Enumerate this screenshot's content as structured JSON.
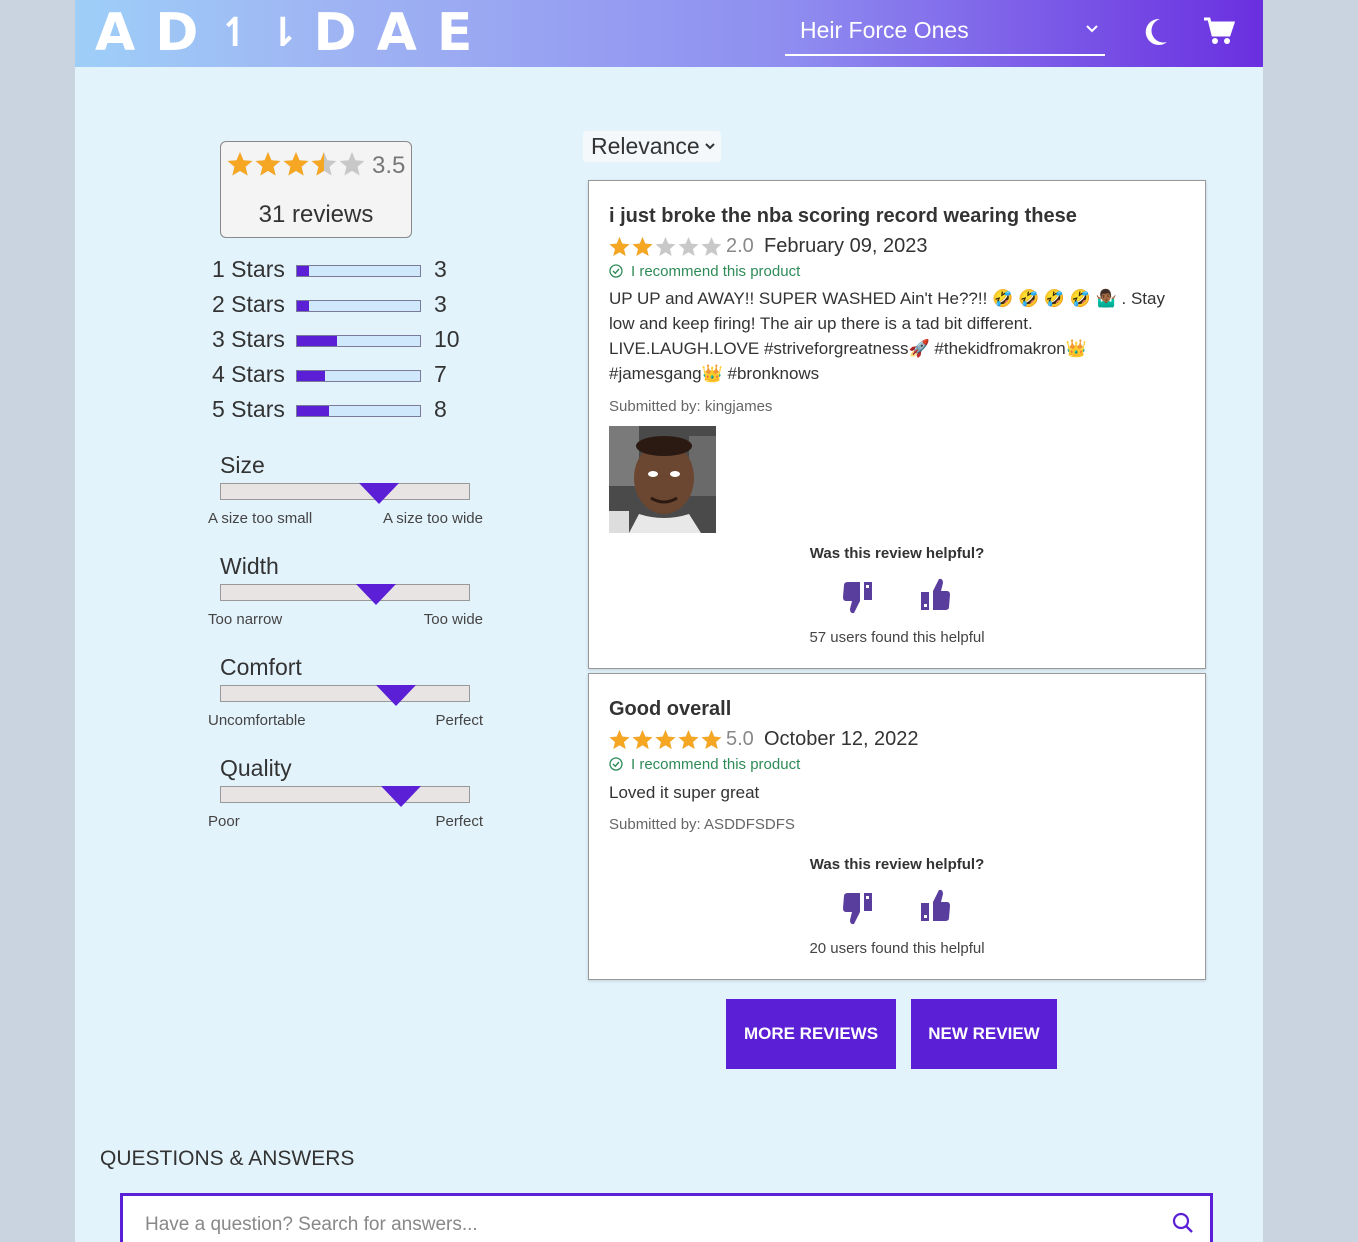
{
  "header": {
    "logo_left": "AD",
    "logo_mid": "↿⇂",
    "logo_right": "DAE",
    "product_selected": "Heir Force Ones",
    "theme_icon": "moon-icon",
    "cart_icon": "cart-icon"
  },
  "ratings": {
    "average": "3.5",
    "average_stars": 3.5,
    "count_label": "31 reviews",
    "breakdown": [
      {
        "label": "1 Stars",
        "count": "3",
        "fraction": 0.097
      },
      {
        "label": "2 Stars",
        "count": "3",
        "fraction": 0.097
      },
      {
        "label": "3 Stars",
        "count": "10",
        "fraction": 0.323
      },
      {
        "label": "4 Stars",
        "count": "7",
        "fraction": 0.226
      },
      {
        "label": "5 Stars",
        "count": "8",
        "fraction": 0.258
      }
    ]
  },
  "characteristics": [
    {
      "name": "Size",
      "low": "A size too small",
      "high": "A size too wide",
      "value": 0.64
    },
    {
      "name": "Width",
      "low": "Too narrow",
      "high": "Too wide",
      "value": 0.63
    },
    {
      "name": "Comfort",
      "low": "Uncomfortable",
      "high": "Perfect",
      "value": 0.71
    },
    {
      "name": "Quality",
      "low": "Poor",
      "high": "Perfect",
      "value": 0.73
    }
  ],
  "sort": {
    "selected": "Relevance"
  },
  "reviews": [
    {
      "title": "i just broke the nba scoring record wearing these",
      "rating": "2.0",
      "stars": 2,
      "date": "February 09, 2023",
      "recommend": "I recommend this product",
      "body": "UP UP and AWAY!! SUPER WASHED Ain't He??!! 🤣 🤣 🤣 🤣 🤷🏾‍♂️ . Stay low and keep firing! The air up there is a tad bit different. LIVE.LAUGH.LOVE #striveforgreatness🚀 #thekidfromakron👑 #jamesgang👑 #bronknows",
      "author": "Submitted by: kingjames",
      "helpful_question": "Was this review helpful?",
      "helpful_count": "57 users found this helpful"
    },
    {
      "title": "Good overall",
      "rating": "5.0",
      "stars": 5,
      "date": "October 12, 2022",
      "recommend": "I recommend this product",
      "body": "Loved it super great",
      "author": "Submitted by: ASDDFSDFS",
      "helpful_question": "Was this review helpful?",
      "helpful_count": "20 users found this helpful"
    }
  ],
  "buttons": {
    "more": "MORE REVIEWS",
    "new": "NEW REVIEW"
  },
  "qa": {
    "heading": "QUESTIONS & ANSWERS",
    "placeholder": "Have a question? Search for answers..."
  },
  "colors": {
    "accent": "#5b1fd6",
    "star": "#f5a623",
    "star_empty": "#c8c8c8",
    "recommend": "#2e8b57"
  }
}
